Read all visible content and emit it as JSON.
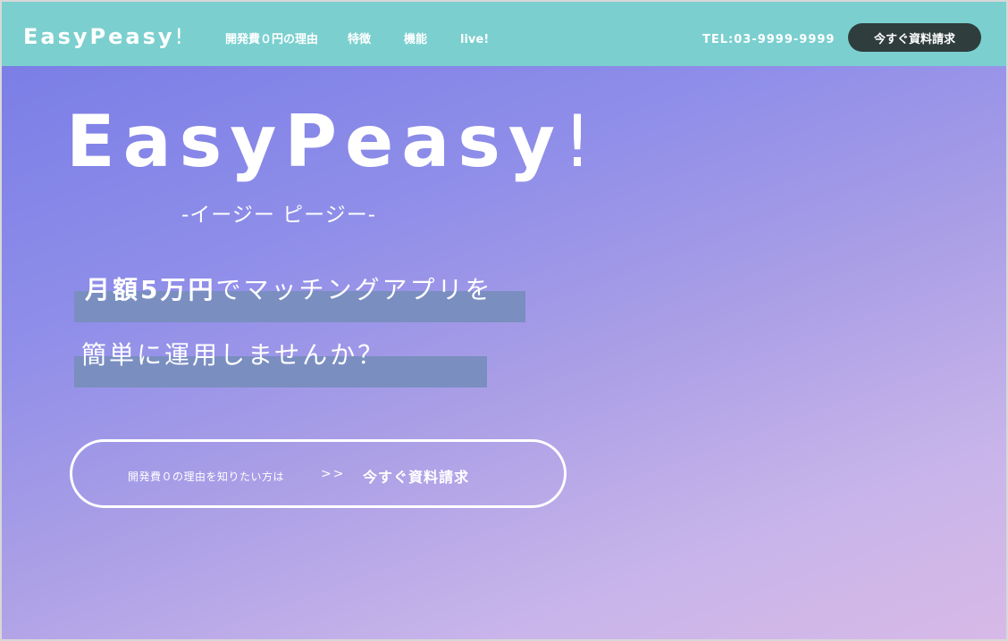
{
  "header": {
    "logo": "EasyPeasy",
    "logo_mark": "!",
    "nav": [
      {
        "label": "開発費０円の理由"
      },
      {
        "label": "特徴"
      },
      {
        "label": "機能"
      },
      {
        "label": "live!"
      }
    ],
    "tel": "TEL:03-9999-9999",
    "cta_label": "今すぐ資料請求"
  },
  "hero": {
    "title": "EasyPeasy",
    "title_mark": "!",
    "reading": "-イージー ピージー-",
    "line1_bold": "月額5万円",
    "line1_rest": "でマッチングアプリを",
    "line2": "簡単に運用しませんか？",
    "cta_pre": "開発費０の理由を知りたい方は",
    "cta_arrows": ">>",
    "cta_main": "今すぐ資料請求"
  },
  "colors": {
    "header_bg": "#7bcfcf",
    "header_cta_bg": "#2f3d3d",
    "highlight": "#7a8ec0",
    "gradient_start": "#7b7ee6",
    "gradient_end": "#d7b9e6"
  }
}
